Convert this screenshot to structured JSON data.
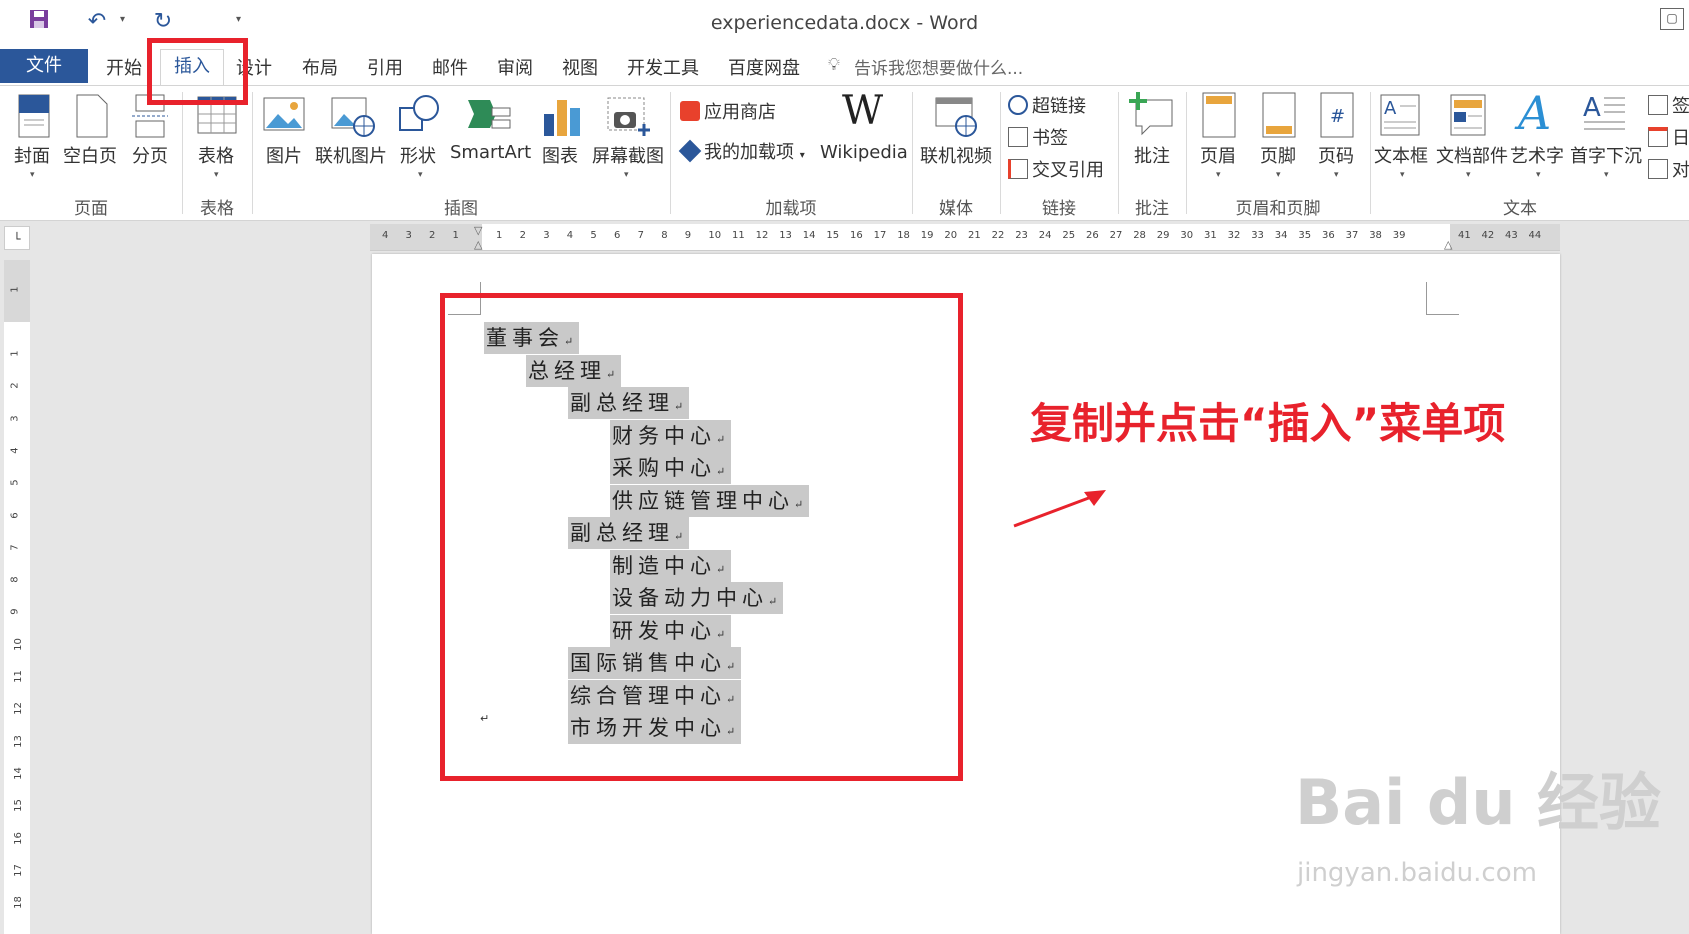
{
  "window": {
    "title": "experiencedata.docx - Word"
  },
  "qat": {
    "save_icon": "save-icon",
    "undo_icon": "undo-icon",
    "redo_icon": "redo-icon",
    "customize_icon": "customize-qat-icon"
  },
  "tabs": [
    {
      "label": "文件"
    },
    {
      "label": "开始"
    },
    {
      "label": "插入"
    },
    {
      "label": "设计"
    },
    {
      "label": "布局"
    },
    {
      "label": "引用"
    },
    {
      "label": "邮件"
    },
    {
      "label": "审阅"
    },
    {
      "label": "视图"
    },
    {
      "label": "开发工具"
    },
    {
      "label": "百度网盘"
    }
  ],
  "tell_me": {
    "placeholder": "告诉我您想要做什么..."
  },
  "ribbon": {
    "pages": {
      "cover": "封面",
      "blank": "空白页",
      "break": "分页",
      "group": "页面"
    },
    "tables": {
      "table": "表格",
      "group": "表格"
    },
    "illustrations": {
      "picture": "图片",
      "online_picture": "联机图片",
      "shapes": "形状",
      "smartart": "SmartArt",
      "chart": "图表",
      "screenshot": "屏幕截图",
      "group": "插图"
    },
    "addins": {
      "store": "应用商店",
      "my_addins": "我的加载项",
      "wikipedia": "Wikipedia",
      "group": "加载项"
    },
    "media": {
      "online_video": "联机视频",
      "group": "媒体"
    },
    "links": {
      "hyperlink": "超链接",
      "bookmark": "书签",
      "cross_ref": "交叉引用",
      "group": "链接"
    },
    "comments": {
      "comment": "批注",
      "group": "批注"
    },
    "header_footer": {
      "header": "页眉",
      "footer": "页脚",
      "page_number": "页码",
      "group": "页眉和页脚"
    },
    "text": {
      "textbox": "文本框",
      "quick_parts": "文档部件",
      "wordart": "艺术字",
      "dropcap": "首字下沉",
      "sig": "签",
      "date": "日",
      "obj": "对",
      "group": "文本"
    }
  },
  "ruler": {
    "h_left": [
      "4",
      "3",
      "2",
      "1"
    ],
    "h_right": [
      "1",
      "2",
      "3",
      "4",
      "5",
      "6",
      "7",
      "8",
      "9",
      "10",
      "11",
      "12",
      "13",
      "14",
      "15",
      "16",
      "17",
      "18",
      "19",
      "20",
      "21",
      "22",
      "23",
      "24",
      "25",
      "26",
      "27",
      "28",
      "29",
      "30",
      "31",
      "32",
      "33",
      "34",
      "35",
      "36",
      "37",
      "38",
      "39"
    ],
    "h_margin": [
      "41",
      "42",
      "43",
      "44"
    ],
    "v": [
      "1",
      "1",
      "2",
      "3",
      "4",
      "5",
      "6",
      "7",
      "8",
      "9",
      "10",
      "11",
      "12",
      "13",
      "14",
      "15",
      "16",
      "17",
      "18"
    ]
  },
  "document": {
    "lines": [
      {
        "text": "董事会",
        "level": 0
      },
      {
        "text": "总经理",
        "level": 1
      },
      {
        "text": "副总经理",
        "level": 2
      },
      {
        "text": "财务中心",
        "level": 3
      },
      {
        "text": "采购中心",
        "level": 3
      },
      {
        "text": "供应链管理中心",
        "level": 3
      },
      {
        "text": "副总经理",
        "level": 2
      },
      {
        "text": "制造中心",
        "level": 3
      },
      {
        "text": "设备动力中心",
        "level": 3
      },
      {
        "text": "研发中心",
        "level": 3
      },
      {
        "text": "国际销售中心",
        "level": 2
      },
      {
        "text": "综合管理中心",
        "level": 2
      },
      {
        "text": "市场开发中心",
        "level": 2
      }
    ],
    "para_mark": "↵"
  },
  "annotation": {
    "text": "复制并点击“插入”菜单项",
    "color": "#e8222c"
  },
  "watermark": {
    "text": "Bai du 经验",
    "sub": "jingyan.baidu.com"
  }
}
